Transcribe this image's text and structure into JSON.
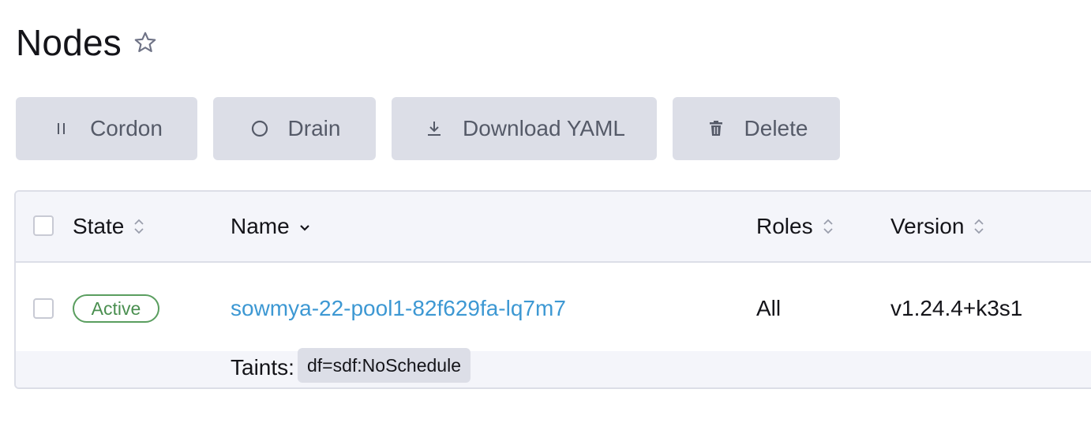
{
  "header": {
    "title": "Nodes",
    "favorite_icon": "star-outline-icon"
  },
  "toolbar": {
    "cordon": {
      "label": "Cordon",
      "icon": "pause-icon"
    },
    "drain": {
      "label": "Drain",
      "icon": "circle-icon"
    },
    "download": {
      "label": "Download YAML",
      "icon": "download-icon"
    },
    "delete": {
      "label": "Delete",
      "icon": "trash-icon"
    }
  },
  "table": {
    "columns": {
      "state": "State",
      "name": "Name",
      "roles": "Roles",
      "version": "Version"
    },
    "rows": [
      {
        "state": "Active",
        "name": "sowmya-22-pool1-82f629fa-lq7m7",
        "roles": "All",
        "version": "v1.24.4+k3s1",
        "taints_label": "Taints:",
        "taints": [
          "df=sdf:NoSchedule"
        ]
      }
    ]
  },
  "colors": {
    "button_bg": "#dcdee7",
    "button_text": "#555a68",
    "link": "#3d98d3",
    "active_badge": "#5a9e5f",
    "header_bg": "#f4f5fa"
  }
}
